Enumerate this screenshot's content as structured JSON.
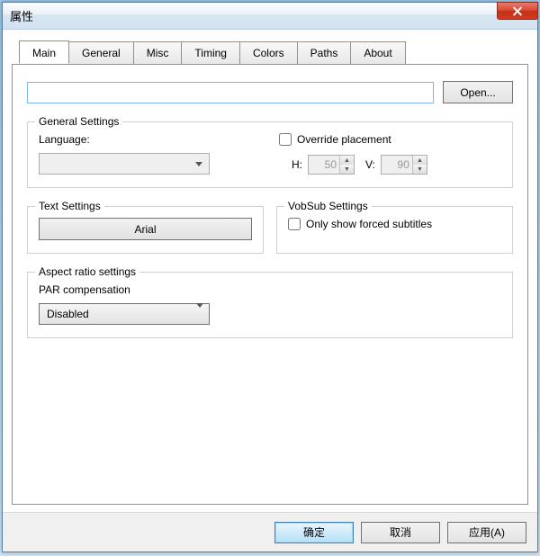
{
  "window": {
    "title": "属性"
  },
  "tabs": {
    "main": "Main",
    "general": "General",
    "misc": "Misc",
    "timing": "Timing",
    "colors": "Colors",
    "paths": "Paths",
    "about": "About"
  },
  "main": {
    "path_value": "",
    "open_label": "Open...",
    "general_settings": {
      "legend": "General Settings",
      "language_label": "Language:",
      "language_value": "",
      "override_label": "Override placement",
      "override_checked": false,
      "h_label": "H:",
      "h_value": "50",
      "v_label": "V:",
      "v_value": "90"
    },
    "text_settings": {
      "legend": "Text Settings",
      "font_button": "Arial"
    },
    "vobsub_settings": {
      "legend": "VobSub Settings",
      "forced_label": "Only show forced subtitles",
      "forced_checked": false
    },
    "aspect_ratio": {
      "legend": "Aspect ratio settings",
      "par_label": "PAR compensation",
      "par_value": "Disabled"
    }
  },
  "footer": {
    "ok": "确定",
    "cancel": "取消",
    "apply": "应用(A)"
  }
}
